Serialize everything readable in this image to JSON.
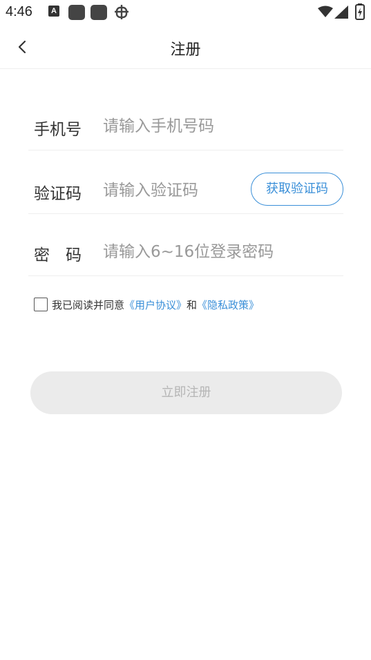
{
  "status_bar": {
    "time": "4:46",
    "notification_icons": [
      "a-icon",
      "app-square-icon",
      "app-square-icon",
      "bug-icon"
    ],
    "right_icons": [
      "wifi-icon",
      "signal-icon",
      "battery-charging-icon"
    ]
  },
  "nav": {
    "title": "注册",
    "back_icon": "chevron-left-icon"
  },
  "form": {
    "phone": {
      "label": "手机号",
      "placeholder": "请输入手机号码",
      "value": ""
    },
    "code": {
      "label": "验证码",
      "placeholder": "请输入验证码",
      "value": "",
      "button_label": "获取验证码"
    },
    "password": {
      "label": "密　码",
      "placeholder": "请输入6~16位登录密码",
      "value": ""
    }
  },
  "agreement": {
    "checked": false,
    "prefix": "我已阅读并同意",
    "user_agreement": "《用户协议》",
    "and": "和",
    "privacy_policy": "《隐私政策》"
  },
  "submit": {
    "label": "立即注册",
    "enabled": false
  },
  "colors": {
    "accent": "#3a8fd8",
    "button_disabled_bg": "#ebebeb",
    "button_disabled_text": "#b5b5b5",
    "divider": "#eeeeee",
    "placeholder": "#999999"
  }
}
